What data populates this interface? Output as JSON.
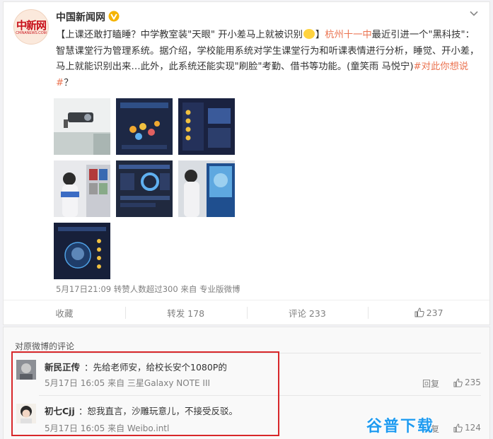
{
  "post": {
    "author": "中国新闻网",
    "avatar_text": "中新网",
    "avatar_sub": "CHINANEWS.COM",
    "text_parts": {
      "p1": "【上课还敢打瞌睡？中学教室装\"天眼\" 开小差马上就被识别",
      "p2": "】",
      "link": "杭州十一中",
      "p3": "最近引进一个\"黑科技\"：智慧课堂行为管理系统。据介绍，学校能用系统对学生课堂行为和听课表情进行分析，睡觉、开小差，马上就能识别出来…此外，此系统还能实现\"刷脸\"考勤、借书等功能。(童笑雨 马悦宁)",
      "topic": "#对此你想说#",
      "p4": "？"
    },
    "meta": "5月17日21:09 转赞人数超过300 来自 专业版微博"
  },
  "actions": {
    "favorite": "收藏",
    "repost": "转发 178",
    "comment": "评论 233",
    "like": "237"
  },
  "comments": {
    "title": "对原微博的评论",
    "items": [
      {
        "name": "新民正传",
        "text": "：先给老师安，给校长安个1080P的",
        "meta": "5月17日 16:05 来自 三星Galaxy NOTE III",
        "reply": "回复",
        "likes": "235"
      },
      {
        "name": "初七Cjj",
        "text": "：恕我直言，沙雕玩意儿，不接受反驳。",
        "meta": "5月17日 16:05 来自 Weibo.intl",
        "reply": "回复",
        "likes": "124"
      }
    ]
  },
  "watermark": "谷普下载",
  "colors": {
    "accent": "#eb7350",
    "highlight": "#d8272a",
    "verified": "#f5b400",
    "watermark": "#1e9bf0"
  }
}
